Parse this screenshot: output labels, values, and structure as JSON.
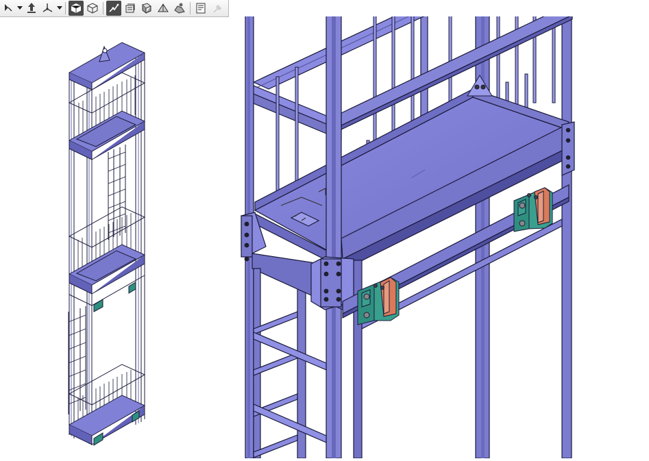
{
  "toolbar": {
    "buttons": [
      {
        "icon": "view-mode-icon",
        "state": "normal"
      },
      {
        "icon": "dropdown-caret-icon",
        "state": "normal"
      },
      {
        "icon": "fly-mode-icon",
        "state": "normal"
      },
      {
        "icon": "axis-compass-icon",
        "state": "normal"
      },
      {
        "icon": "dropdown-caret-icon",
        "state": "normal"
      },
      {
        "icon": "shading-with-edges-icon",
        "state": "active"
      },
      {
        "icon": "wireframe-icon",
        "state": "normal"
      },
      {
        "icon": "hide-show-icon",
        "state": "active"
      },
      {
        "icon": "swap-visible-space-icon",
        "state": "normal"
      },
      {
        "icon": "normal-view-icon",
        "state": "normal"
      },
      {
        "icon": "multi-view-icon",
        "state": "normal"
      },
      {
        "icon": "apply-material-icon",
        "state": "normal"
      },
      {
        "icon": "properties-icon",
        "state": "normal"
      },
      {
        "icon": "color-picker-icon",
        "state": "disabled"
      }
    ]
  },
  "colors": {
    "steel": "#8080d6",
    "steel_dark": "#5a5aa8",
    "edge": "#1a1a3a",
    "guide_body": "#2f8f7f",
    "guide_shoe": "#d97b5a",
    "background": "#ffffff"
  }
}
